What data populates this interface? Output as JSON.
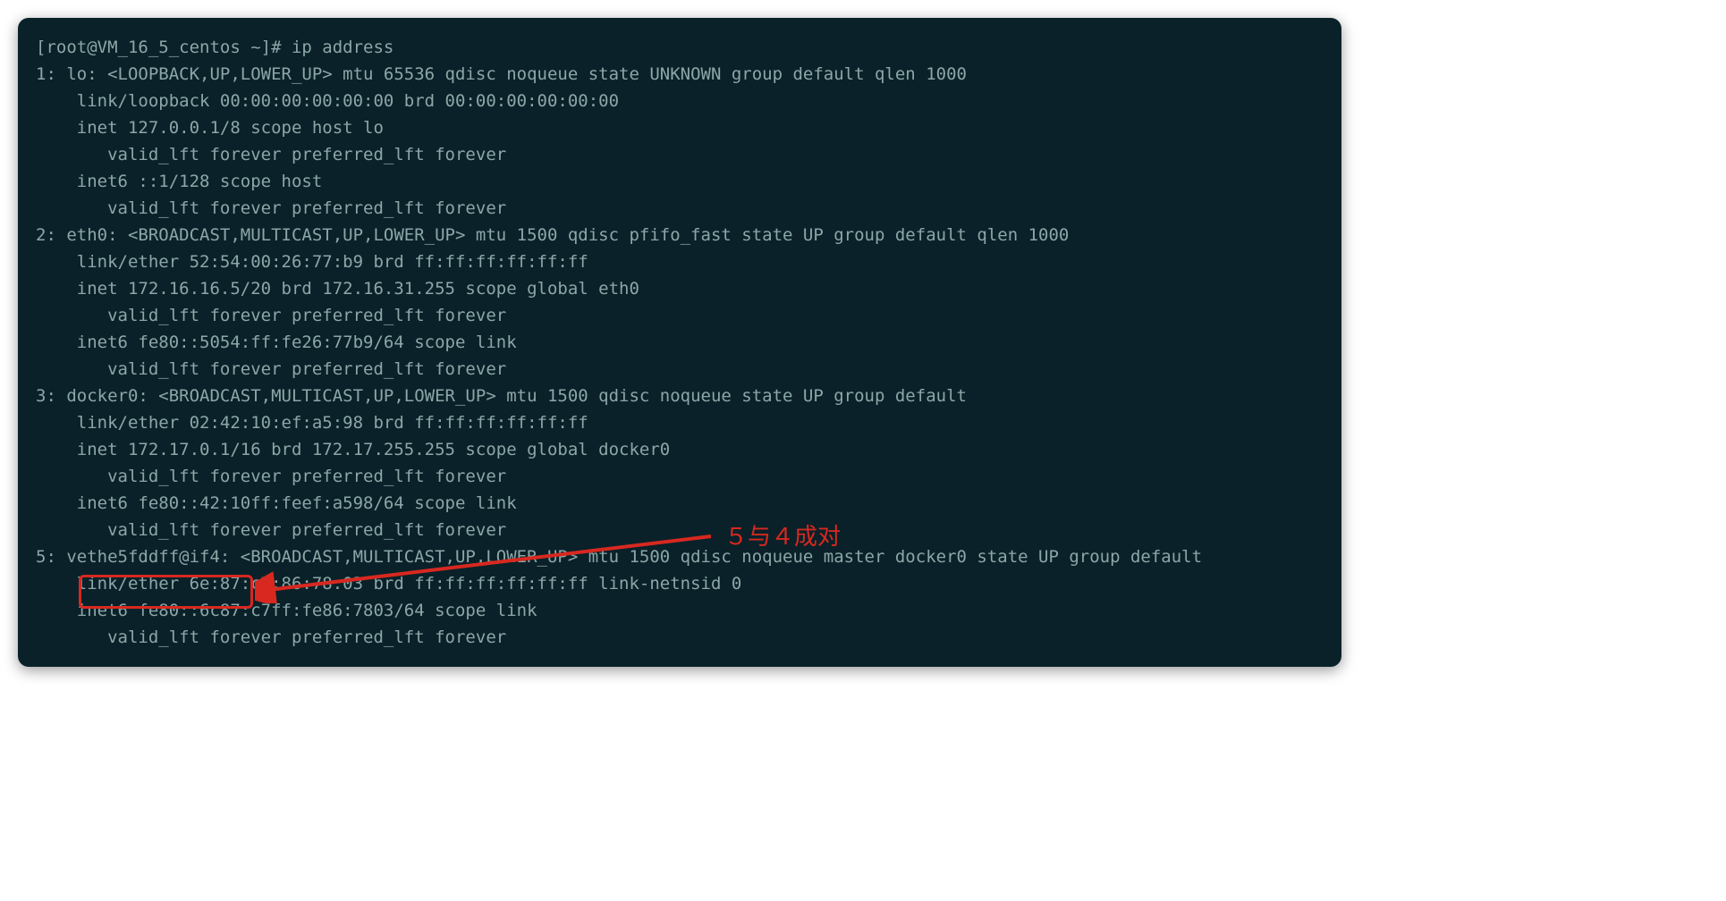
{
  "prompt": "[root@VM_16_5_centos ~]# ip address",
  "lines": [
    "1: lo: <LOOPBACK,UP,LOWER_UP> mtu 65536 qdisc noqueue state UNKNOWN group default qlen 1000",
    "    link/loopback 00:00:00:00:00:00 brd 00:00:00:00:00:00",
    "    inet 127.0.0.1/8 scope host lo",
    "       valid_lft forever preferred_lft forever",
    "    inet6 ::1/128 scope host",
    "       valid_lft forever preferred_lft forever",
    "2: eth0: <BROADCAST,MULTICAST,UP,LOWER_UP> mtu 1500 qdisc pfifo_fast state UP group default qlen 1000",
    "    link/ether 52:54:00:26:77:b9 brd ff:ff:ff:ff:ff:ff",
    "    inet 172.16.16.5/20 brd 172.16.31.255 scope global eth0",
    "       valid_lft forever preferred_lft forever",
    "    inet6 fe80::5054:ff:fe26:77b9/64 scope link",
    "       valid_lft forever preferred_lft forever",
    "3: docker0: <BROADCAST,MULTICAST,UP,LOWER_UP> mtu 1500 qdisc noqueue state UP group default",
    "    link/ether 02:42:10:ef:a5:98 brd ff:ff:ff:ff:ff:ff",
    "    inet 172.17.0.1/16 brd 172.17.255.255 scope global docker0",
    "       valid_lft forever preferred_lft forever",
    "    inet6 fe80::42:10ff:feef:a598/64 scope link",
    "       valid_lft forever preferred_lft forever",
    "5: vethe5fddff@if4: <BROADCAST,MULTICAST,UP,LOWER_UP> mtu 1500 qdisc noqueue master docker0 state UP group default",
    "    link/ether 6e:87:c7:86:78:03 brd ff:ff:ff:ff:ff:ff link-netnsid 0",
    "    inet6 fe80::6c87:c7ff:fe86:7803/64 scope link",
    "       valid_lft forever preferred_lft forever"
  ],
  "annotation": "５与４成对",
  "highlighted_text": "vethe5fddff@if4:",
  "colors": {
    "terminal_bg": "#0a2129",
    "terminal_fg": "#8ba7a7",
    "annotation_red": "#d82820"
  }
}
